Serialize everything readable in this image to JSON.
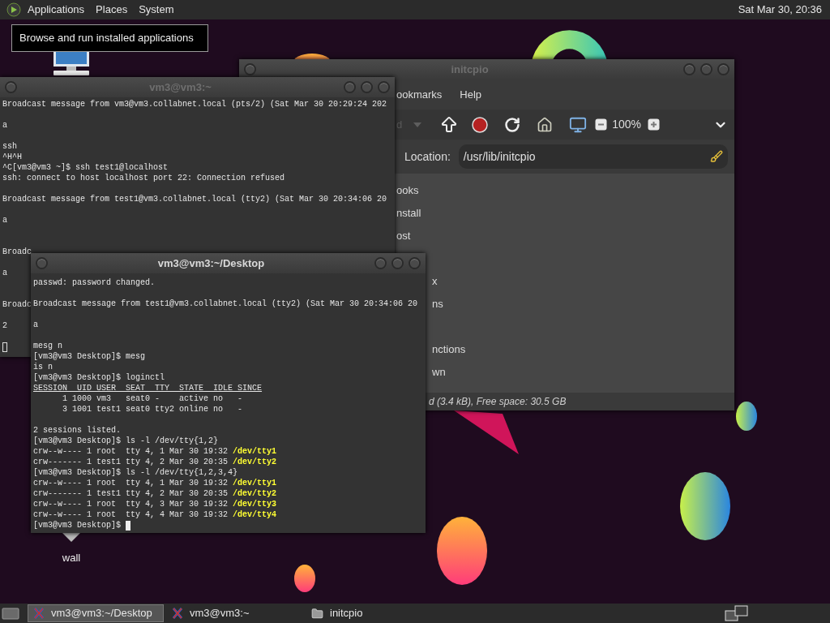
{
  "top_panel": {
    "menus": [
      "Applications",
      "Places",
      "System"
    ],
    "clock": "Sat Mar 30, 20:36"
  },
  "tooltip": "Browse and run installed applications",
  "desktop_icons": [
    {
      "kind": "computer"
    },
    {
      "kind": "file",
      "label": "wall"
    }
  ],
  "file_manager": {
    "title": "initcpio",
    "menus": [
      "ookmarks",
      "Help"
    ],
    "toolbar": {
      "partial_label": "d",
      "partial_disabled": true,
      "zoom": "100%"
    },
    "location": {
      "label": "Location:",
      "value": "/usr/lib/initcpio"
    },
    "files": [
      {
        "kind": "name",
        "name": "ooks"
      },
      {
        "kind": "name",
        "name": "nstall"
      },
      {
        "kind": "name",
        "name": "ost"
      },
      {
        "kind": "covered"
      },
      {
        "kind": "tail",
        "name": "x"
      },
      {
        "kind": "tail",
        "name": "ns"
      },
      {
        "kind": "covered"
      },
      {
        "kind": "tail",
        "name": "nctions"
      },
      {
        "kind": "tail",
        "name": "wn"
      }
    ],
    "status": "d (3.4 kB), Free space: 30.5 GB"
  },
  "terminals": [
    {
      "title": "vm3@vm3:~",
      "focused": false,
      "lines": [
        {
          "kind": "text",
          "text": "Broadcast message from vm3@vm3.collabnet.local (pts/2) (Sat Mar 30 20:29:24 202"
        },
        {
          "kind": "blank"
        },
        {
          "kind": "text",
          "text": "a"
        },
        {
          "kind": "blank"
        },
        {
          "kind": "text",
          "text": "ssh"
        },
        {
          "kind": "text",
          "text": "^H^H"
        },
        {
          "kind": "text",
          "text": "^C[vm3@vm3 ~]$ ssh test1@localhost"
        },
        {
          "kind": "text",
          "text": "ssh: connect to host localhost port 22: Connection refused"
        },
        {
          "kind": "blank"
        },
        {
          "kind": "text",
          "text": "Broadcast message from test1@vm3.collabnet.local (tty2) (Sat Mar 30 20:34:06 20"
        },
        {
          "kind": "blank"
        },
        {
          "kind": "text",
          "text": "a"
        },
        {
          "kind": "blank"
        },
        {
          "kind": "blank"
        },
        {
          "kind": "text",
          "text": "Broadc"
        },
        {
          "kind": "blank"
        },
        {
          "kind": "text",
          "text": "a"
        },
        {
          "kind": "blank"
        },
        {
          "kind": "blank"
        },
        {
          "kind": "text",
          "text": "Broadc"
        },
        {
          "kind": "blank"
        },
        {
          "kind": "text",
          "text": "2"
        },
        {
          "kind": "blank"
        },
        {
          "kind": "outline_cursor"
        }
      ]
    },
    {
      "title": "vm3@vm3:~/Desktop",
      "focused": true,
      "lines": [
        {
          "kind": "text",
          "text": "passwd: password changed."
        },
        {
          "kind": "blank"
        },
        {
          "kind": "text",
          "text": "Broadcast message from test1@vm3.collabnet.local (tty2) (Sat Mar 30 20:34:06 20"
        },
        {
          "kind": "blank"
        },
        {
          "kind": "text",
          "text": "a"
        },
        {
          "kind": "blank"
        },
        {
          "kind": "text",
          "text": "mesg n"
        },
        {
          "kind": "text",
          "text": "[vm3@vm3 Desktop]$ mesg"
        },
        {
          "kind": "text",
          "text": "is n"
        },
        {
          "kind": "text",
          "text": "[vm3@vm3 Desktop]$ loginctl"
        },
        {
          "kind": "header",
          "text": "SESSION  UID USER  SEAT  TTY  STATE  IDLE SINCE"
        },
        {
          "kind": "text",
          "text": "      1 1000 vm3   seat0 -    active no   -"
        },
        {
          "kind": "text",
          "text": "      3 1001 test1 seat0 tty2 online no   -"
        },
        {
          "kind": "blank"
        },
        {
          "kind": "text",
          "text": "2 sessions listed."
        },
        {
          "kind": "text",
          "text": "[vm3@vm3 Desktop]$ ls -l /dev/tty{1,2}"
        },
        {
          "kind": "file",
          "text": "crw--w---- 1 root  tty 4, 1 Mar 30 19:32",
          "path": "/dev/tty1"
        },
        {
          "kind": "file",
          "text": "crw------- 1 test1 tty 4, 2 Mar 30 20:35",
          "path": "/dev/tty2"
        },
        {
          "kind": "text",
          "text": "[vm3@vm3 Desktop]$ ls -l /dev/tty{1,2,3,4}"
        },
        {
          "kind": "file",
          "text": "crw--w---- 1 root  tty 4, 1 Mar 30 19:32",
          "path": "/dev/tty1"
        },
        {
          "kind": "file",
          "text": "crw------- 1 test1 tty 4, 2 Mar 30 20:35",
          "path": "/dev/tty2"
        },
        {
          "kind": "file",
          "text": "crw--w---- 1 root  tty 4, 3 Mar 30 19:32",
          "path": "/dev/tty3"
        },
        {
          "kind": "file",
          "text": "crw--w---- 1 root  tty 4, 4 Mar 30 19:32",
          "path": "/dev/tty4"
        },
        {
          "kind": "prompt",
          "text": "[vm3@vm3 Desktop]$"
        }
      ]
    }
  ],
  "taskbar": {
    "tasks": [
      {
        "kind": "terminal",
        "label": "vm3@vm3:~/Desktop",
        "selected": true
      },
      {
        "kind": "terminal",
        "label": "vm3@vm3:~",
        "selected": false
      },
      {
        "kind": "folder",
        "label": "initcpio",
        "selected": false
      }
    ]
  }
}
